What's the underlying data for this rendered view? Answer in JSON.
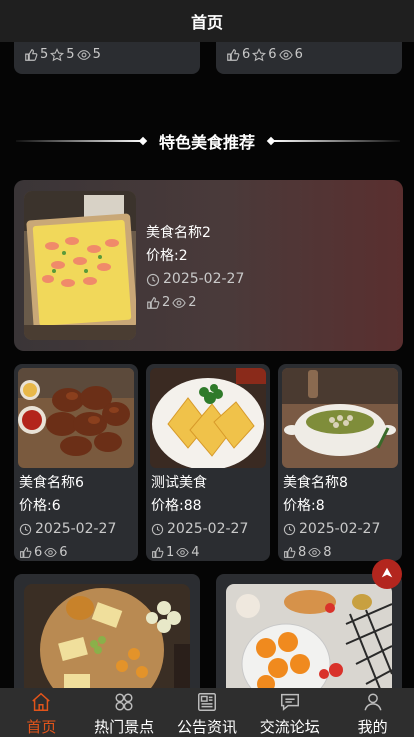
{
  "header": {
    "title": "首页"
  },
  "prev_cards": [
    {
      "likes": "5",
      "stars": "5",
      "views": "5"
    },
    {
      "likes": "6",
      "stars": "6",
      "views": "6"
    }
  ],
  "section": {
    "title": "特色美食推荐"
  },
  "featured": {
    "name": "美食名称2",
    "price": "价格:2",
    "date": "2025-02-27",
    "likes": "2",
    "views": "2"
  },
  "foods": [
    {
      "name": "美食名称6",
      "price": "价格:6",
      "date": "2025-02-27",
      "likes": "6",
      "views": "6"
    },
    {
      "name": "测试美食",
      "price": "价格:88",
      "date": "2025-02-27",
      "likes": "1",
      "views": "4"
    },
    {
      "name": "美食名称8",
      "price": "价格:8",
      "date": "2025-02-27",
      "likes": "8",
      "views": "8"
    }
  ],
  "tabbar": {
    "items": [
      {
        "label": "首页",
        "icon": "home-icon"
      },
      {
        "label": "热门景点",
        "icon": "grid-icon"
      },
      {
        "label": "公告资讯",
        "icon": "news-icon"
      },
      {
        "label": "交流论坛",
        "icon": "chat-icon"
      },
      {
        "label": "我的",
        "icon": "user-icon"
      }
    ],
    "active_color": "#e2541a"
  },
  "colors": {
    "card": "#2b2d31",
    "accent": "#b3261e"
  }
}
